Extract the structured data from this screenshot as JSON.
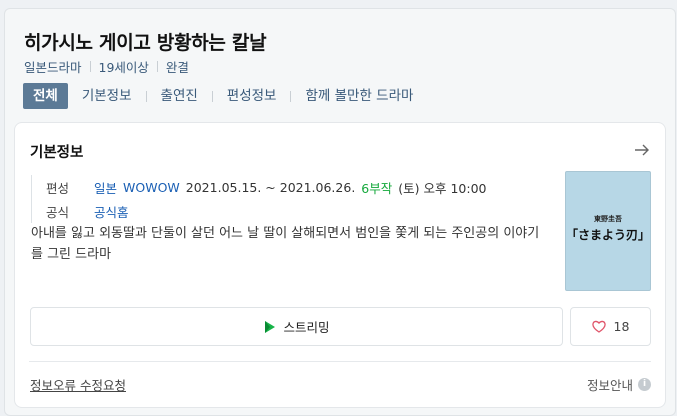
{
  "header": {
    "title": "히가시노 게이고 방황하는 칼날",
    "meta": [
      "일본드라마",
      "19세이상",
      "완결"
    ]
  },
  "tabs": [
    {
      "label": "전체",
      "active": true
    },
    {
      "label": "기본정보"
    },
    {
      "label": "출연진"
    },
    {
      "label": "편성정보"
    },
    {
      "label": "함께 볼만한 드라마"
    }
  ],
  "card": {
    "title": "기본정보",
    "broadcast": {
      "label": "편성",
      "country": "일본",
      "channel": "WOWOW",
      "dates": "2021.05.15. ~ 2021.06.26.",
      "episodes": "6부작",
      "schedule": "(토) 오후 10:00"
    },
    "official": {
      "label": "공식",
      "link": "공식홈"
    },
    "description": "아내를 잃고 외동딸과 단둘이 살던 어느 날 딸이 살해되면서 범인을 쫓게 되는 주인공의 이야기를 그린 드라마",
    "poster": {
      "small_text": "東野圭吾",
      "big_text": "「さまよう刃」"
    },
    "streaming_label": "스트리밍",
    "like_count": "18",
    "report_label": "정보오류 수정요청",
    "info_guide_label": "정보안내"
  }
}
